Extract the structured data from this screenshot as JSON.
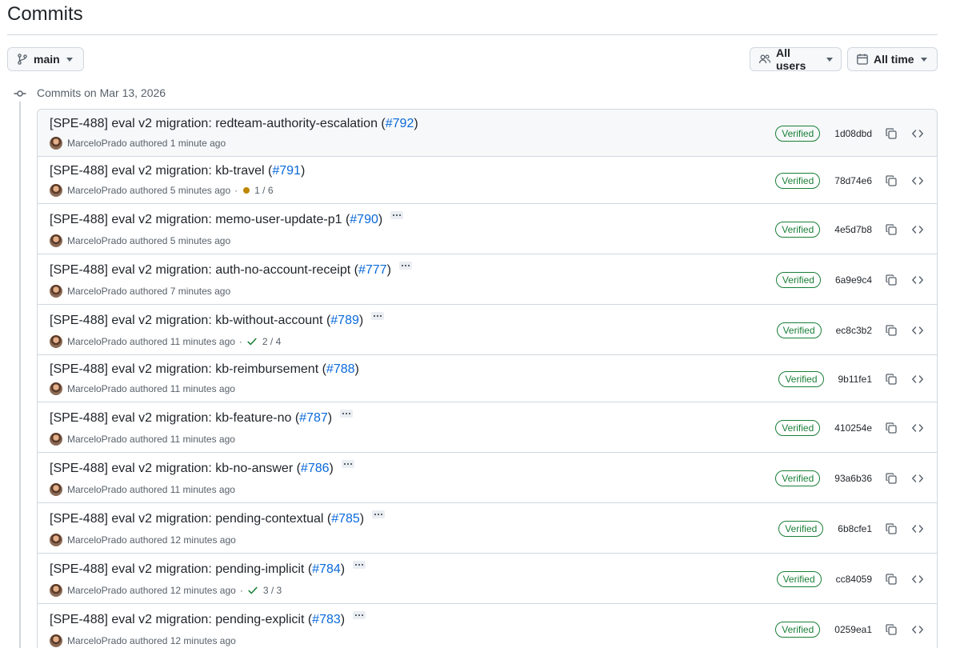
{
  "page": {
    "title": "Commits"
  },
  "toolbar": {
    "branch": "main",
    "users": "All users",
    "time": "All time"
  },
  "group": {
    "heading": "Commits on Mar 13, 2026"
  },
  "commits": [
    {
      "title": "[SPE-488] eval v2 migration: redteam-authority-escalation (",
      "pr": "#792",
      "close": ")",
      "author": "MarceloPrado",
      "authored": "authored 1 minute ago",
      "status": "",
      "sha": "1d08dbd",
      "verified": "Verified"
    },
    {
      "title": "[SPE-488] eval v2 migration: kb-travel (",
      "pr": "#791",
      "close": ")",
      "author": "MarceloPrado",
      "authored": "authored 5 minutes ago",
      "status": "1 / 6",
      "sha": "78d74e6",
      "verified": "Verified"
    },
    {
      "title": "[SPE-488] eval v2 migration: memo-user-update-p1 (",
      "pr": "#790",
      "close": ")",
      "author": "MarceloPrado",
      "authored": "authored 5 minutes ago",
      "status": "",
      "sha": "4e5d7b8",
      "verified": "Verified"
    },
    {
      "title": "[SPE-488] eval v2 migration: auth-no-account-receipt (",
      "pr": "#777",
      "close": ")",
      "author": "MarceloPrado",
      "authored": "authored 7 minutes ago",
      "status": "",
      "sha": "6a9e9c4",
      "verified": "Verified"
    },
    {
      "title": "[SPE-488] eval v2 migration: kb-without-account (",
      "pr": "#789",
      "close": ")",
      "author": "MarceloPrado",
      "authored": "authored 11 minutes ago",
      "status": "2 / 4",
      "sha": "ec8c3b2",
      "verified": "Verified"
    },
    {
      "title": "[SPE-488] eval v2 migration: kb-reimbursement (",
      "pr": "#788",
      "close": ")",
      "author": "MarceloPrado",
      "authored": "authored 11 minutes ago",
      "status": "",
      "sha": "9b11fe1",
      "verified": "Verified"
    },
    {
      "title": "[SPE-488] eval v2 migration: kb-feature-no (",
      "pr": "#787",
      "close": ")",
      "author": "MarceloPrado",
      "authored": "authored 11 minutes ago",
      "status": "",
      "sha": "410254e",
      "verified": "Verified"
    },
    {
      "title": "[SPE-488] eval v2 migration: kb-no-answer (",
      "pr": "#786",
      "close": ")",
      "author": "MarceloPrado",
      "authored": "authored 11 minutes ago",
      "status": "",
      "sha": "93a6b36",
      "verified": "Verified"
    },
    {
      "title": "[SPE-488] eval v2 migration: pending-contextual (",
      "pr": "#785",
      "close": ")",
      "author": "MarceloPrado",
      "authored": "authored 12 minutes ago",
      "status": "",
      "sha": "6b8cfe1",
      "verified": "Verified"
    },
    {
      "title": "[SPE-488] eval v2 migration: pending-implicit (",
      "pr": "#784",
      "close": ")",
      "author": "MarceloPrado",
      "authored": "authored 12 minutes ago",
      "status": "3 / 3",
      "sha": "cc84059",
      "verified": "Verified"
    },
    {
      "title": "[SPE-488] eval v2 migration: pending-explicit (",
      "pr": "#783",
      "close": ")",
      "author": "MarceloPrado",
      "authored": "authored 12 minutes ago",
      "status": "",
      "sha": "0259ea1",
      "verified": "Verified"
    }
  ],
  "colors": {
    "link": "#0969da",
    "verified": "#1a7f37",
    "pending": "#bf8700",
    "border": "#d0d7de"
  }
}
